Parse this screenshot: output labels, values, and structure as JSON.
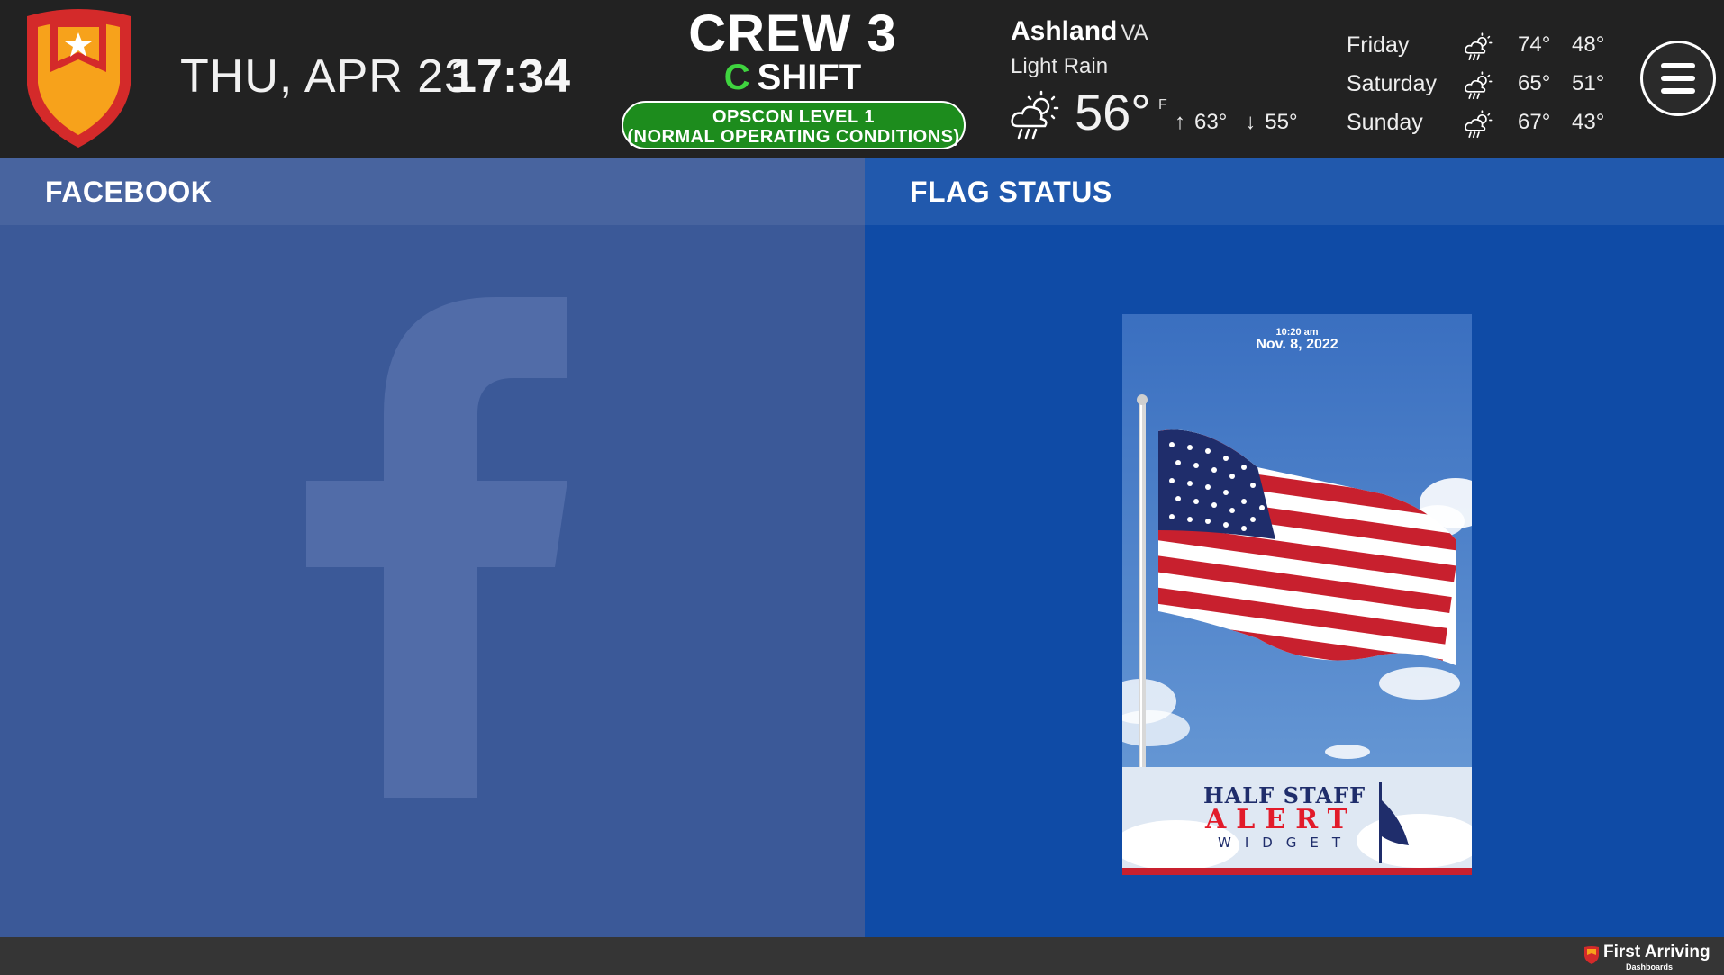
{
  "header": {
    "date": "THU, APR 23",
    "time": "17:34",
    "crew": "CREW 3",
    "shift_letter": "C",
    "shift_label": "SHIFT",
    "opscon_line1": "OPSCON LEVEL 1",
    "opscon_line2": "(NORMAL OPERATING CONDITIONS)"
  },
  "weather": {
    "city": "Ashland",
    "state": "VA",
    "condition": "Light Rain",
    "icon": "partly-cloudy-rain-icon",
    "temp": "56°",
    "unit": "F",
    "high": "63°",
    "low": "55°",
    "forecast": [
      {
        "day": "Friday",
        "high": "74°",
        "low": "48°",
        "icon": "partly-cloudy-rain-icon"
      },
      {
        "day": "Saturday",
        "high": "65°",
        "low": "51°",
        "icon": "partly-cloudy-rain-icon"
      },
      {
        "day": "Sunday",
        "high": "67°",
        "low": "43°",
        "icon": "partly-cloudy-rain-icon"
      }
    ]
  },
  "panels": {
    "facebook_title": "FACEBOOK",
    "flag_title": "FLAG STATUS"
  },
  "flag_widget": {
    "time": "10:20 am",
    "date": "Nov. 8, 2022",
    "line1": "HALF STAFF",
    "line2": "ALERT",
    "line3": "WIDGET"
  },
  "footer": {
    "brand": "First Arriving",
    "sub": "Dashboards"
  },
  "colors": {
    "header_bg": "#222222",
    "facebook_bg": "#3b5998",
    "flag_bg": "#0f4ba6",
    "opscon_green": "#1d8c1d",
    "shift_green": "#3fd43f",
    "logo_red": "#d42a2a",
    "logo_orange": "#f7a21b"
  }
}
